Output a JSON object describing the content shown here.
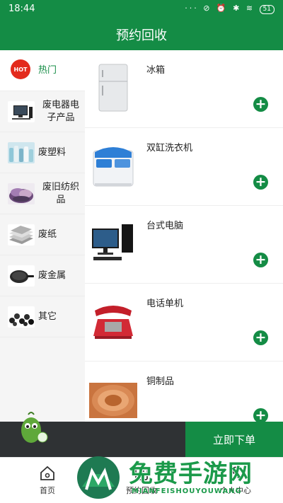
{
  "status_bar": {
    "time": "18:44",
    "icons": "··· ⊘ ⏰ ✱ ≋",
    "battery": "51"
  },
  "app_bar": {
    "title": "预约回收"
  },
  "sidebar": {
    "hot_badge": "HOT",
    "items": [
      {
        "label": "热门",
        "icon": "hot-icon"
      },
      {
        "label": "废电器电子产品",
        "icon": "computer-thumb"
      },
      {
        "label": "废塑料",
        "icon": "plastic-bottles-thumb"
      },
      {
        "label": "废旧纺织品",
        "icon": "textiles-thumb"
      },
      {
        "label": "废纸",
        "icon": "paper-stack-thumb"
      },
      {
        "label": "废金属",
        "icon": "frying-pan-thumb"
      },
      {
        "label": "其它",
        "icon": "rubber-pieces-thumb"
      }
    ]
  },
  "products": [
    {
      "name": "冰箱",
      "icon": "refrigerator-image"
    },
    {
      "name": "双缸洗衣机",
      "icon": "washing-machine-image"
    },
    {
      "name": "台式电脑",
      "icon": "desktop-computer-image"
    },
    {
      "name": "电话单机",
      "icon": "telephone-image"
    },
    {
      "name": "铜制品",
      "icon": "copper-coil-image"
    }
  ],
  "add_symbol": "+",
  "action_bar": {
    "order_label": "立即下单"
  },
  "tabs": [
    {
      "label": "首页",
      "icon": "home-icon"
    },
    {
      "label": "预约回收",
      "icon": "recycle-order-icon"
    },
    {
      "label": "个人中心",
      "icon": "person-icon"
    }
  ],
  "watermark": {
    "title": "免费手游网",
    "subtitle": "MIANFEISHOUYOUWANG"
  },
  "colors": {
    "brand_green": "#148c45",
    "hot_red": "#e32a1c",
    "dark_bar": "#2f3234"
  }
}
